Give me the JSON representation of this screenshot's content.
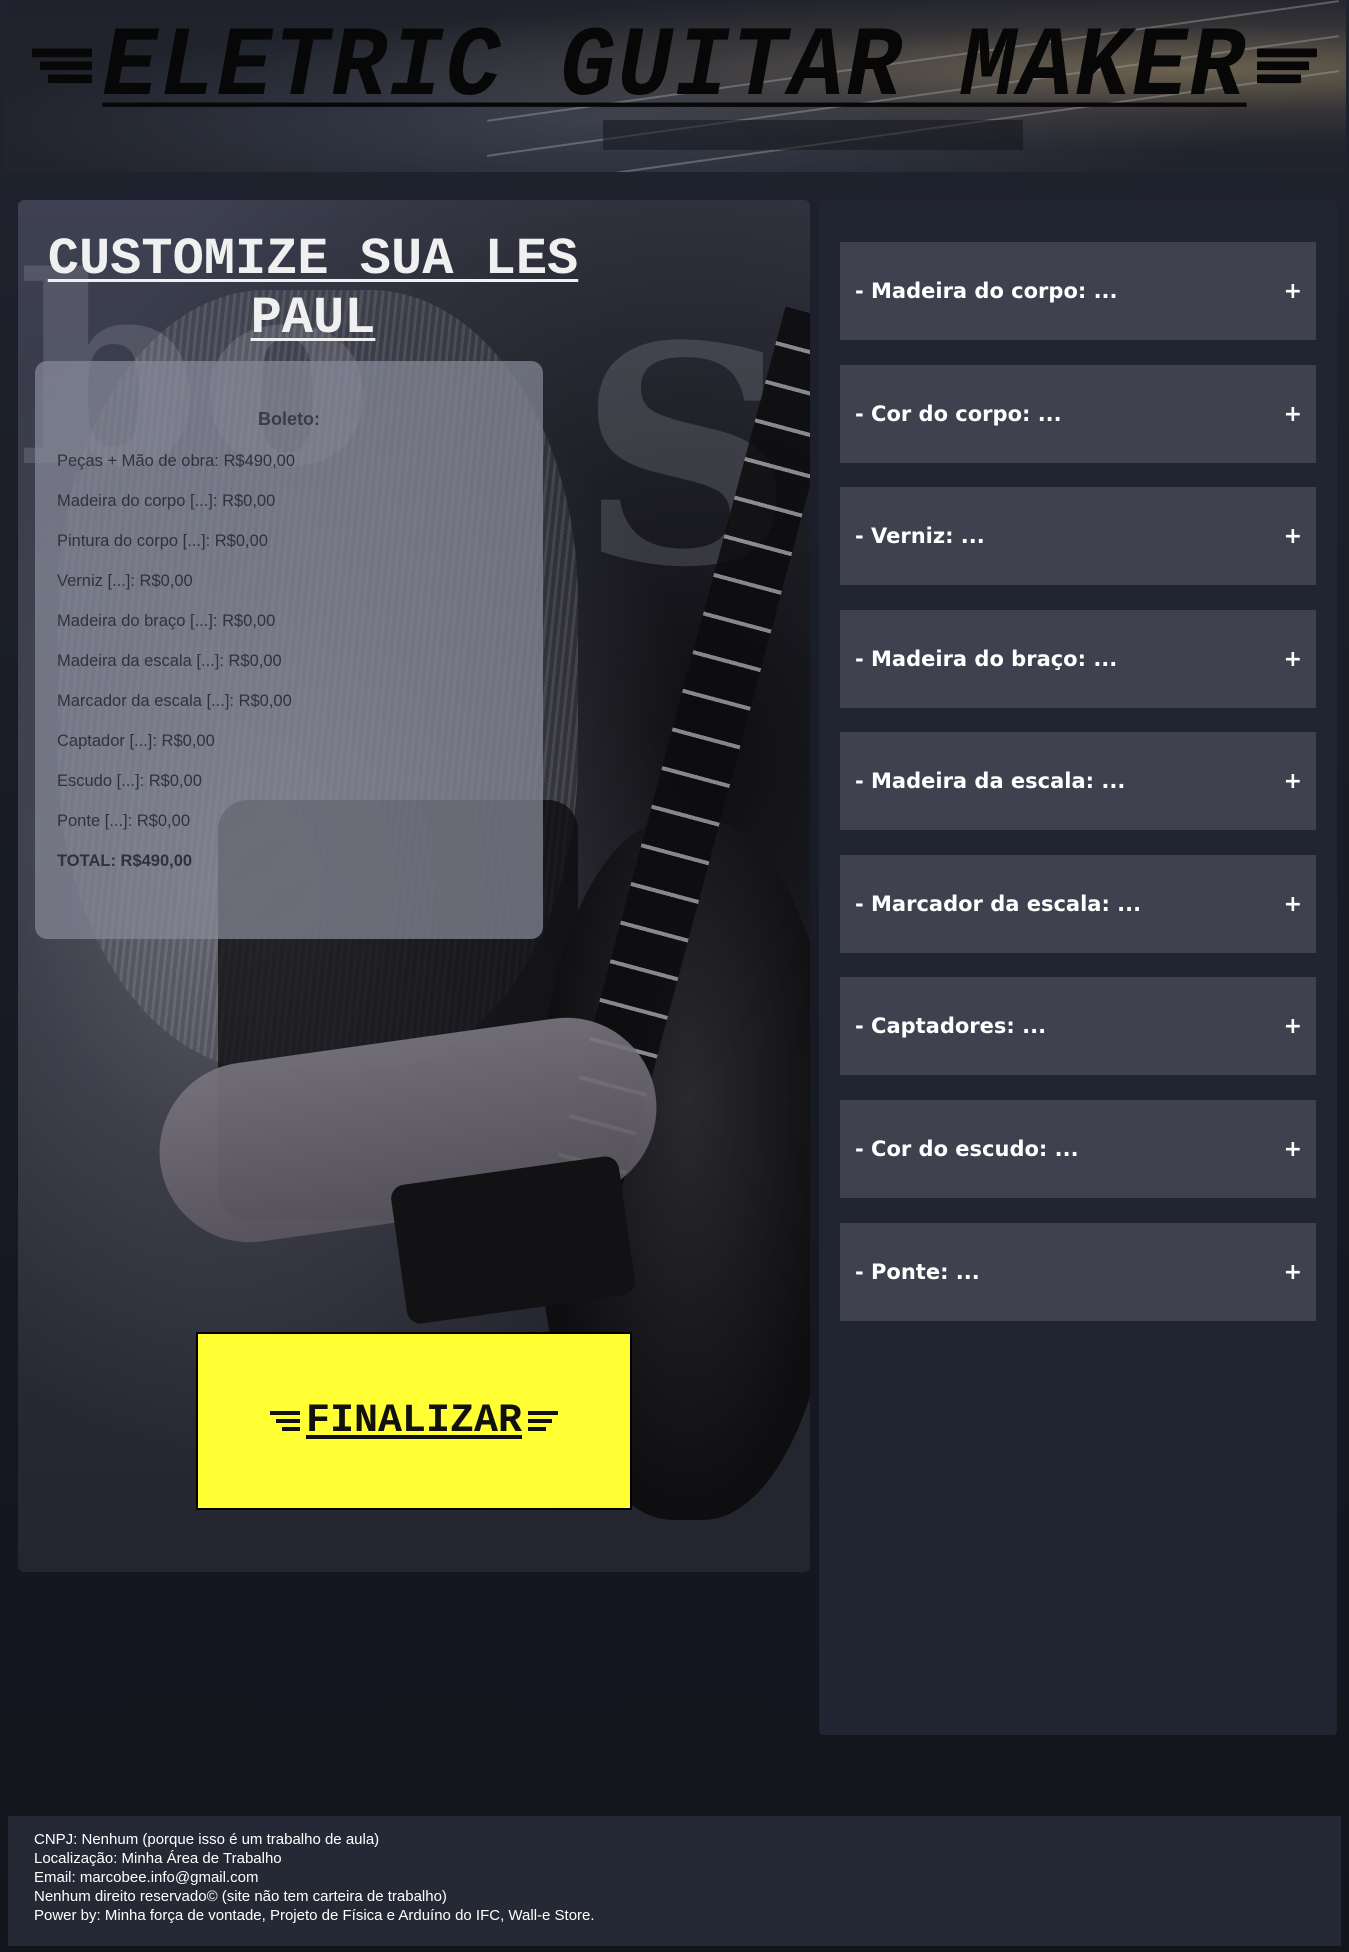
{
  "header": {
    "title": "ELETRIC GUITAR MAKER"
  },
  "customizer": {
    "title": "CUSTOMIZE SUA LES PAUL",
    "receipt": {
      "heading": "Boleto:",
      "lines": [
        "Peças + Mão de obra: R$490,00",
        "Madeira do corpo [...]: R$0,00",
        "Pintura do corpo [...]: R$0,00",
        "Verniz [...]: R$0,00",
        "Madeira do braço [...]: R$0,00",
        "Madeira da escala [...]: R$0,00",
        "Marcador da escala [...]: R$0,00",
        "Captador [...]: R$0,00",
        "Escudo [...]: R$0,00",
        "Ponte [...]: R$0,00"
      ],
      "total": "TOTAL: R$490,00"
    },
    "finalize_label": "FINALIZAR"
  },
  "options": [
    {
      "label": "- Madeira do corpo: ...",
      "toggle": "+"
    },
    {
      "label": "- Cor do corpo: ...",
      "toggle": "+"
    },
    {
      "label": "- Verniz: ...",
      "toggle": "+"
    },
    {
      "label": "- Madeira do braço: ...",
      "toggle": "+"
    },
    {
      "label": "- Madeira da escala: ...",
      "toggle": "+"
    },
    {
      "label": "- Marcador da escala: ...",
      "toggle": "+"
    },
    {
      "label": "- Captadores: ...",
      "toggle": "+"
    },
    {
      "label": "- Cor do escudo: ...",
      "toggle": "+"
    },
    {
      "label": "- Ponte: ...",
      "toggle": "+"
    }
  ],
  "footer": {
    "lines": [
      "CNPJ: Nenhum (porque isso é um trabalho de aula)",
      "Localização: Minha Área de Trabalho",
      "Email: marcobee.info@gmail.com",
      "Nenhum direito reservado© (site não tem carteira de trabalho)",
      "Power by: Minha força de vontade, Projeto de Física e Arduíno do IFC, Wall-e Store."
    ]
  },
  "colors": {
    "accent_button": "#ffff33",
    "option_bg": "#3f414f",
    "panel_bg": "#212431",
    "page_bg": "#161922"
  }
}
